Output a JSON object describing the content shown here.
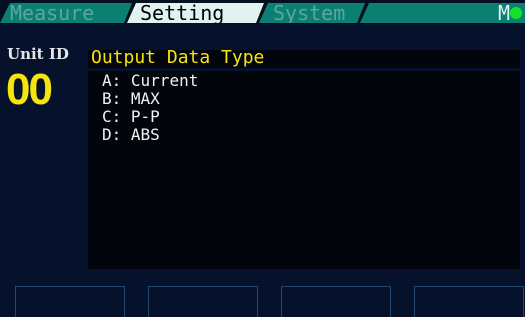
{
  "tabs": [
    {
      "label": "Measure",
      "active": false
    },
    {
      "label": "Setting",
      "active": true
    },
    {
      "label": "System",
      "active": false
    },
    {
      "label": "M",
      "active": false
    }
  ],
  "status_indicator": {
    "color": "#14e32a"
  },
  "unit": {
    "label": "Unit ID",
    "value": "00"
  },
  "panel": {
    "title": "Output Data Type",
    "options": [
      {
        "key": "A:",
        "label": "Current"
      },
      {
        "key": "B:",
        "label": "MAX"
      },
      {
        "key": "C:",
        "label": "P-P"
      },
      {
        "key": "D:",
        "label": "ABS"
      }
    ]
  },
  "colors": {
    "background": "#06122b",
    "tab_inactive": "#0c7f73",
    "tab_active": "#e0f3f0",
    "accent_yellow": "#f5e40d",
    "panel_bg": "#02050c"
  }
}
